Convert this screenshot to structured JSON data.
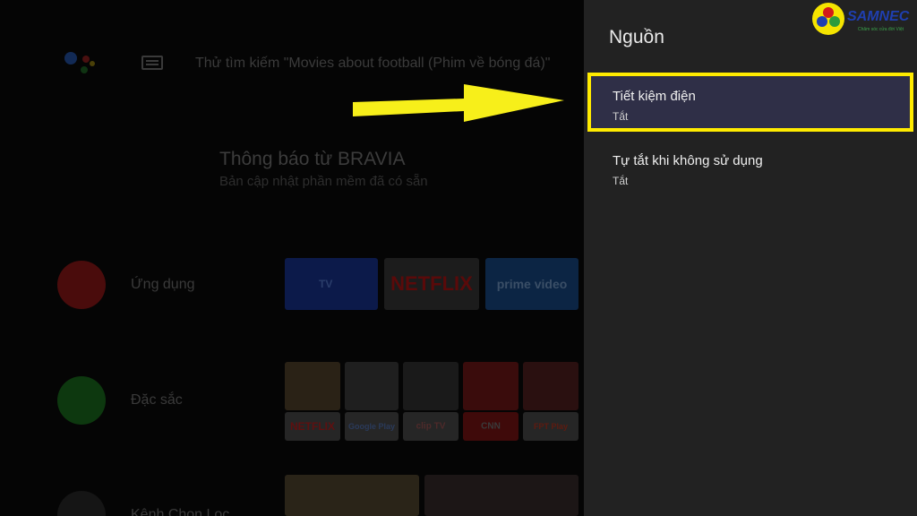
{
  "search": {
    "hint": "Thử tìm kiếm \"Movies about football (Phim về bóng đá)\""
  },
  "notification": {
    "title": "Thông báo từ BRAVIA",
    "subtitle": "Bản cập nhật phần mềm đã có sẵn"
  },
  "rows": [
    {
      "label": "Ứng dụng",
      "icon": "apps-grid-icon",
      "color": "#5a0e0e"
    },
    {
      "label": "Đặc sắc",
      "icon": "featured-icon",
      "color": "#0f3d10"
    },
    {
      "label": "Kênh Chọn Lọc",
      "icon": "channels-icon",
      "color": "#1a1a1a"
    }
  ],
  "apps": [
    {
      "label": "TV",
      "color": "#0d1e55"
    },
    {
      "label": "NETFLIX",
      "color": "#1b1b1b",
      "text_color": "#5a0a0a"
    },
    {
      "label": "prime video",
      "color": "#0d2948",
      "text_color": "#3a4e66"
    }
  ],
  "featured_tiles": [
    {
      "label": "NETFLIX",
      "color": "#2a2a2a",
      "text_color": "#5e1010"
    },
    {
      "label": "Google Play",
      "color": "#2a2a2a",
      "text_color": "#2a3a5a"
    },
    {
      "label": "clip TV",
      "color": "#2a2a2a",
      "text_color": "#4e2a2a"
    },
    {
      "label": "CNN",
      "color": "#4a0c0c",
      "text_color": "#3a3a3a"
    },
    {
      "label": "FPT Play",
      "color": "#2a2a2a",
      "text_color": "#5e1b10"
    }
  ],
  "panel": {
    "title": "Nguồn",
    "settings": [
      {
        "label": "Tiết kiệm điện",
        "value": "Tắt",
        "selected": true
      },
      {
        "label": "Tự tắt khi không sử dụng",
        "value": "Tắt",
        "selected": false
      }
    ]
  },
  "logo": {
    "name": "SAMNEC",
    "slogan": "Chăm sóc cửa đời Việt"
  },
  "colors": {
    "highlight": "#ffeb00",
    "panel_bg": "#222222",
    "selected_bg": "#2f2f47"
  }
}
